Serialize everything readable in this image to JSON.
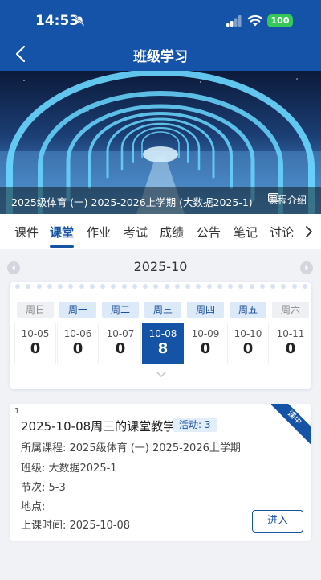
{
  "status_bar": {
    "time": "14:53",
    "battery": "100",
    "icons": [
      "mute-icon",
      "signal-icon",
      "wifi-icon",
      "battery-icon"
    ]
  },
  "header": {
    "title": "班级学习",
    "back_icon": "chevron-left-icon"
  },
  "banner": {
    "course_name": "2025级体育 (一) 2025-2026上学期 (大数据2025-1)",
    "intro_label": "课程介绍",
    "intro_icon": "document-icon"
  },
  "tabs": {
    "items": [
      "课件",
      "课堂",
      "作业",
      "考试",
      "成绩",
      "公告",
      "笔记",
      "讨论"
    ],
    "active": "课堂",
    "more_icon": "chevron-right-icon"
  },
  "calendar": {
    "month": "2025-10",
    "weekdays": [
      "周日",
      "周一",
      "周二",
      "周三",
      "周四",
      "周五",
      "周六"
    ],
    "days": [
      {
        "date": "10-05",
        "count": "0"
      },
      {
        "date": "10-06",
        "count": "0"
      },
      {
        "date": "10-07",
        "count": "0"
      },
      {
        "date": "10-08",
        "count": "8"
      },
      {
        "date": "10-09",
        "count": "0"
      },
      {
        "date": "10-10",
        "count": "0"
      },
      {
        "date": "10-11",
        "count": "0"
      }
    ],
    "selected_date": "10-08"
  },
  "lesson": {
    "index": "1",
    "status_ribbon": "课中",
    "title": "2025-10-08周三的课堂教学",
    "activity": "活动: 3",
    "course": "所属课程: 2025级体育 (一) 2025-2026上学期",
    "class": "班级: 大数据2025-1",
    "period": "节次: 5-3",
    "location": "地点:",
    "start_time": "上课时间: 2025-10-08",
    "enter_label": "进入"
  },
  "colors": {
    "primary": "#1553a6",
    "header": "#1453a8",
    "background": "#f1f2f6",
    "battery": "#35c759"
  }
}
